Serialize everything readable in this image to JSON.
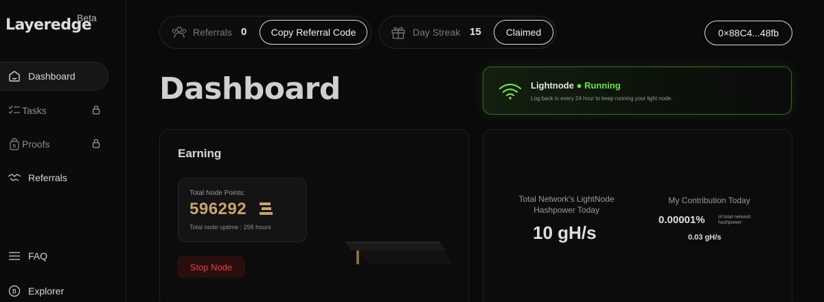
{
  "brand": {
    "logo": "Layeredge",
    "tag": "Beta"
  },
  "sidebar": {
    "items": [
      {
        "label": "Dashboard",
        "icon": "dashboard-icon"
      },
      {
        "label": "Tasks",
        "icon": "tasks-icon",
        "locked": true
      },
      {
        "label": "Proofs",
        "icon": "proofs-icon",
        "locked": true
      },
      {
        "label": "Referrals",
        "icon": "referrals-icon"
      },
      {
        "label": "FAQ",
        "icon": "faq-icon"
      },
      {
        "label": "Explorer",
        "icon": "explorer-icon"
      }
    ]
  },
  "header": {
    "referrals": {
      "label": "Referrals",
      "value": "0",
      "button": "Copy Referral Code"
    },
    "streak": {
      "label": "Day Streak",
      "value": "15",
      "button": "Claimed"
    },
    "wallet": "0×88C4...48fb"
  },
  "page": {
    "title": "Dashboard"
  },
  "status": {
    "node": "Lightnode",
    "dot": "●",
    "state": "Running",
    "note": "Log back in every 24 hour to keep running your light node.",
    "accent": "#6ee04f"
  },
  "earning": {
    "title": "Earning",
    "points_label": "Total Node Points:",
    "points_value": "596292",
    "uptime": "Total node uptime : 298 hours",
    "stop_button": "Stop Node",
    "points_color": "#c9a56a",
    "stop_color": "#e04444"
  },
  "network": {
    "total_label_line1": "Total Network's LightNode",
    "total_label_line2": "Hashpower Today",
    "total_value": "10 gH/s",
    "contrib_label": "My Contribution Today",
    "contrib_percent": "0.00001%",
    "contrib_note_line1": "of total network",
    "contrib_note_line2": "hashpower",
    "contrib_hash": "0.03 gH/s"
  }
}
